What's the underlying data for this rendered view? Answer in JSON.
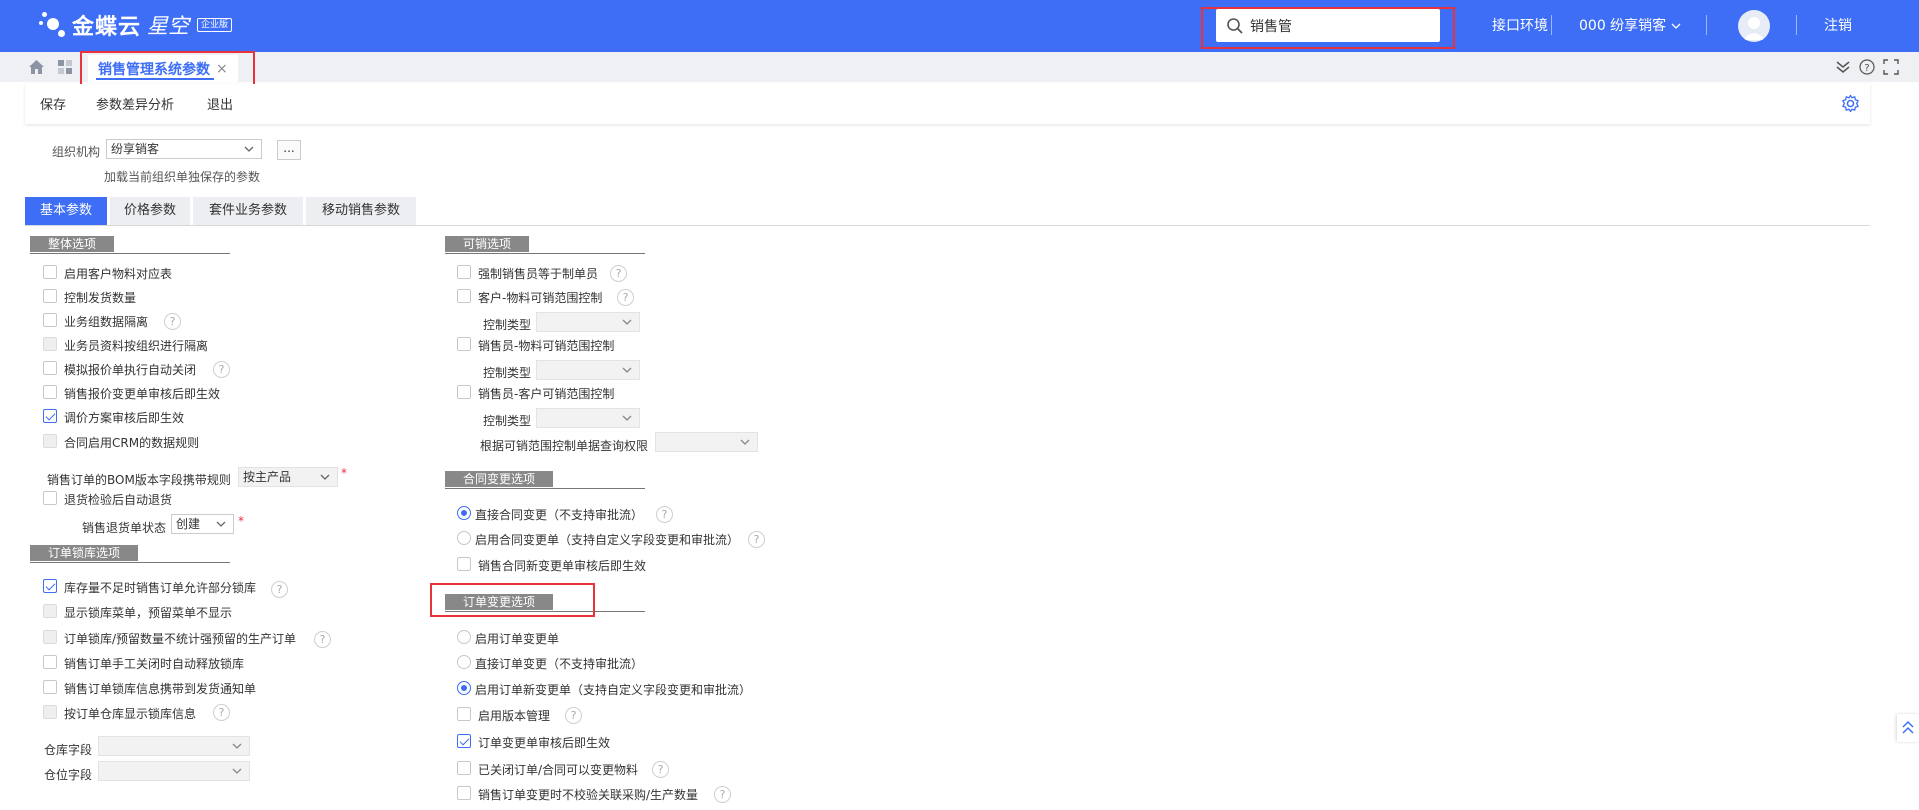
{
  "header": {
    "logo_name": "金蝶云",
    "logo_sub": "星空",
    "logo_badge": "企业版",
    "search_value": "销售管",
    "env_link": "接口环境",
    "org_menu": "000 纷享销客",
    "logout": "注销",
    "brand_color": "#3d6ef5"
  },
  "tabstrip": {
    "page_tab_label": "销售管理系统参数",
    "close_glyph": "×"
  },
  "toolbar": {
    "save": "保存",
    "diff": "参数差异分析",
    "exit": "退出"
  },
  "org": {
    "label": "组织机构",
    "value": "纷享销客",
    "more": "...",
    "hint": "加载当前组织单独保存的参数"
  },
  "param_tabs": [
    "基本参数",
    "价格参数",
    "套件业务参数",
    "移动销售参数"
  ],
  "help_glyph": "?",
  "required_mark": "*",
  "left": {
    "group1_title": "整体选项",
    "group1_items": [
      "启用客户物料对应表",
      "控制发货数量",
      "业务组数据隔离",
      "业务员资料按组织进行隔离",
      "模拟报价单执行自动关闭",
      "销售报价变更单审核后即生效",
      "调价方案审核后即生效",
      "合同启用CRM的数据规则"
    ],
    "bom_label": "销售订单的BOM版本字段携带规则",
    "bom_value": "按主产品",
    "return_check": "退货检验后自动退货",
    "return_state_label": "销售退货单状态",
    "return_state_value": "创建",
    "group2_title": "订单锁库选项",
    "group2_items": [
      "库存量不足时销售订单允许部分锁库",
      "显示锁库菜单，预留菜单不显示",
      "订单锁库/预留数量不统计强预留的生产订单",
      "销售订单手工关闭时自动释放锁库",
      "销售订单锁库信息携带到发货通知单",
      "按订单仓库显示锁库信息"
    ],
    "warehouse_label": "仓库字段",
    "location_label": "仓位字段"
  },
  "right": {
    "group1_title": "可销选项",
    "items": [
      "强制销售员等于制单员",
      "客户-物料可销范围控制",
      "销售员-物料可销范围控制",
      "销售员-客户可销范围控制"
    ],
    "control_type_label": "控制类型",
    "query_perm_label": "根据可销范围控制单据查询权限",
    "group2_title": "合同变更选项",
    "contract_radios": [
      "直接合同变更（不支持审批流）",
      "启用合同变更单（支持自定义字段变更和审批流）"
    ],
    "contract_check": "销售合同新变更单审核后即生效",
    "group3_title": "订单变更选项",
    "order_radios": [
      "启用订单变更单",
      "直接订单变更（不支持审批流）",
      "启用订单新变更单（支持自定义字段变更和审批流）"
    ],
    "order_checks": [
      "启用版本管理",
      "订单变更单审核后即生效",
      "已关闭订单/合同可以变更物料",
      "销售订单变更时不校验关联采购/生产数量"
    ]
  }
}
